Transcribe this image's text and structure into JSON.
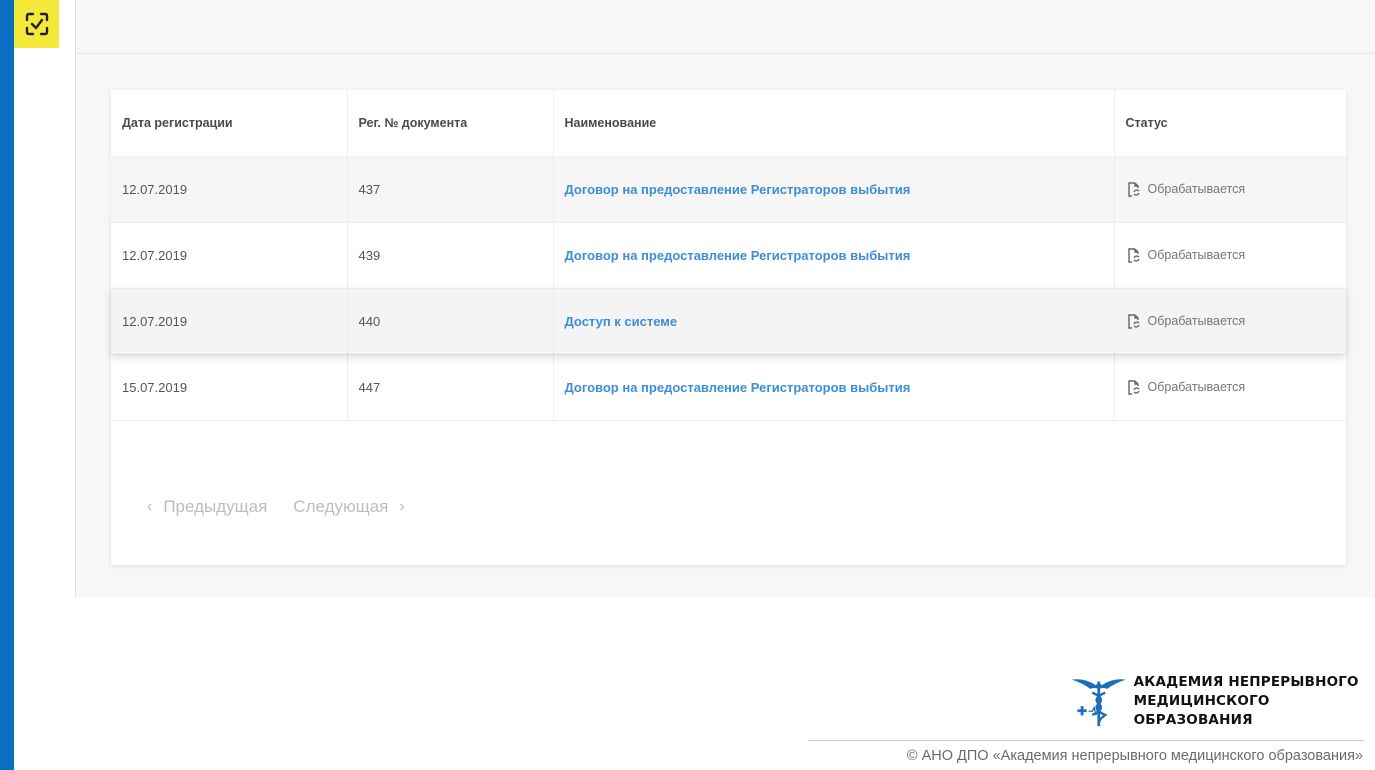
{
  "table": {
    "headers": [
      "Дата регистрации",
      "Рег. № документа",
      "Наименование",
      "Статус"
    ],
    "rows": [
      {
        "date": "12.07.2019",
        "number": "437",
        "name": "Договор на предоставление Регистраторов выбытия",
        "status": "Обрабатывается"
      },
      {
        "date": "12.07.2019",
        "number": "439",
        "name": "Договор на предоставление Регистраторов выбытия",
        "status": "Обрабатывается"
      },
      {
        "date": "12.07.2019",
        "number": "440",
        "name": "Доступ к системе",
        "status": "Обрабатывается"
      },
      {
        "date": "15.07.2019",
        "number": "447",
        "name": "Договор на предоставление Регистраторов выбытия",
        "status": "Обрабатывается"
      }
    ]
  },
  "pagination": {
    "prev_label": "Предыдущая",
    "next_label": "Следующая"
  },
  "footer": {
    "brand_line1": "АКАДЕМИЯ НЕПРЕРЫВНОГО",
    "brand_line2": "МЕДИЦИНСКОГО ОБРАЗОВАНИЯ",
    "copyright": "© АНО ДПО «Академия непрерывного медицинского образования»"
  },
  "icons": {
    "app_logo": "scan-check-icon",
    "status": "document-sync-icon",
    "prev": "chevron-left-icon",
    "next": "chevron-right-icon",
    "brand": "caduceus-icon"
  },
  "colors": {
    "accent_bar": "#0a6fc2",
    "logo_bg": "#f3e93a",
    "link": "#3d8ed8"
  }
}
